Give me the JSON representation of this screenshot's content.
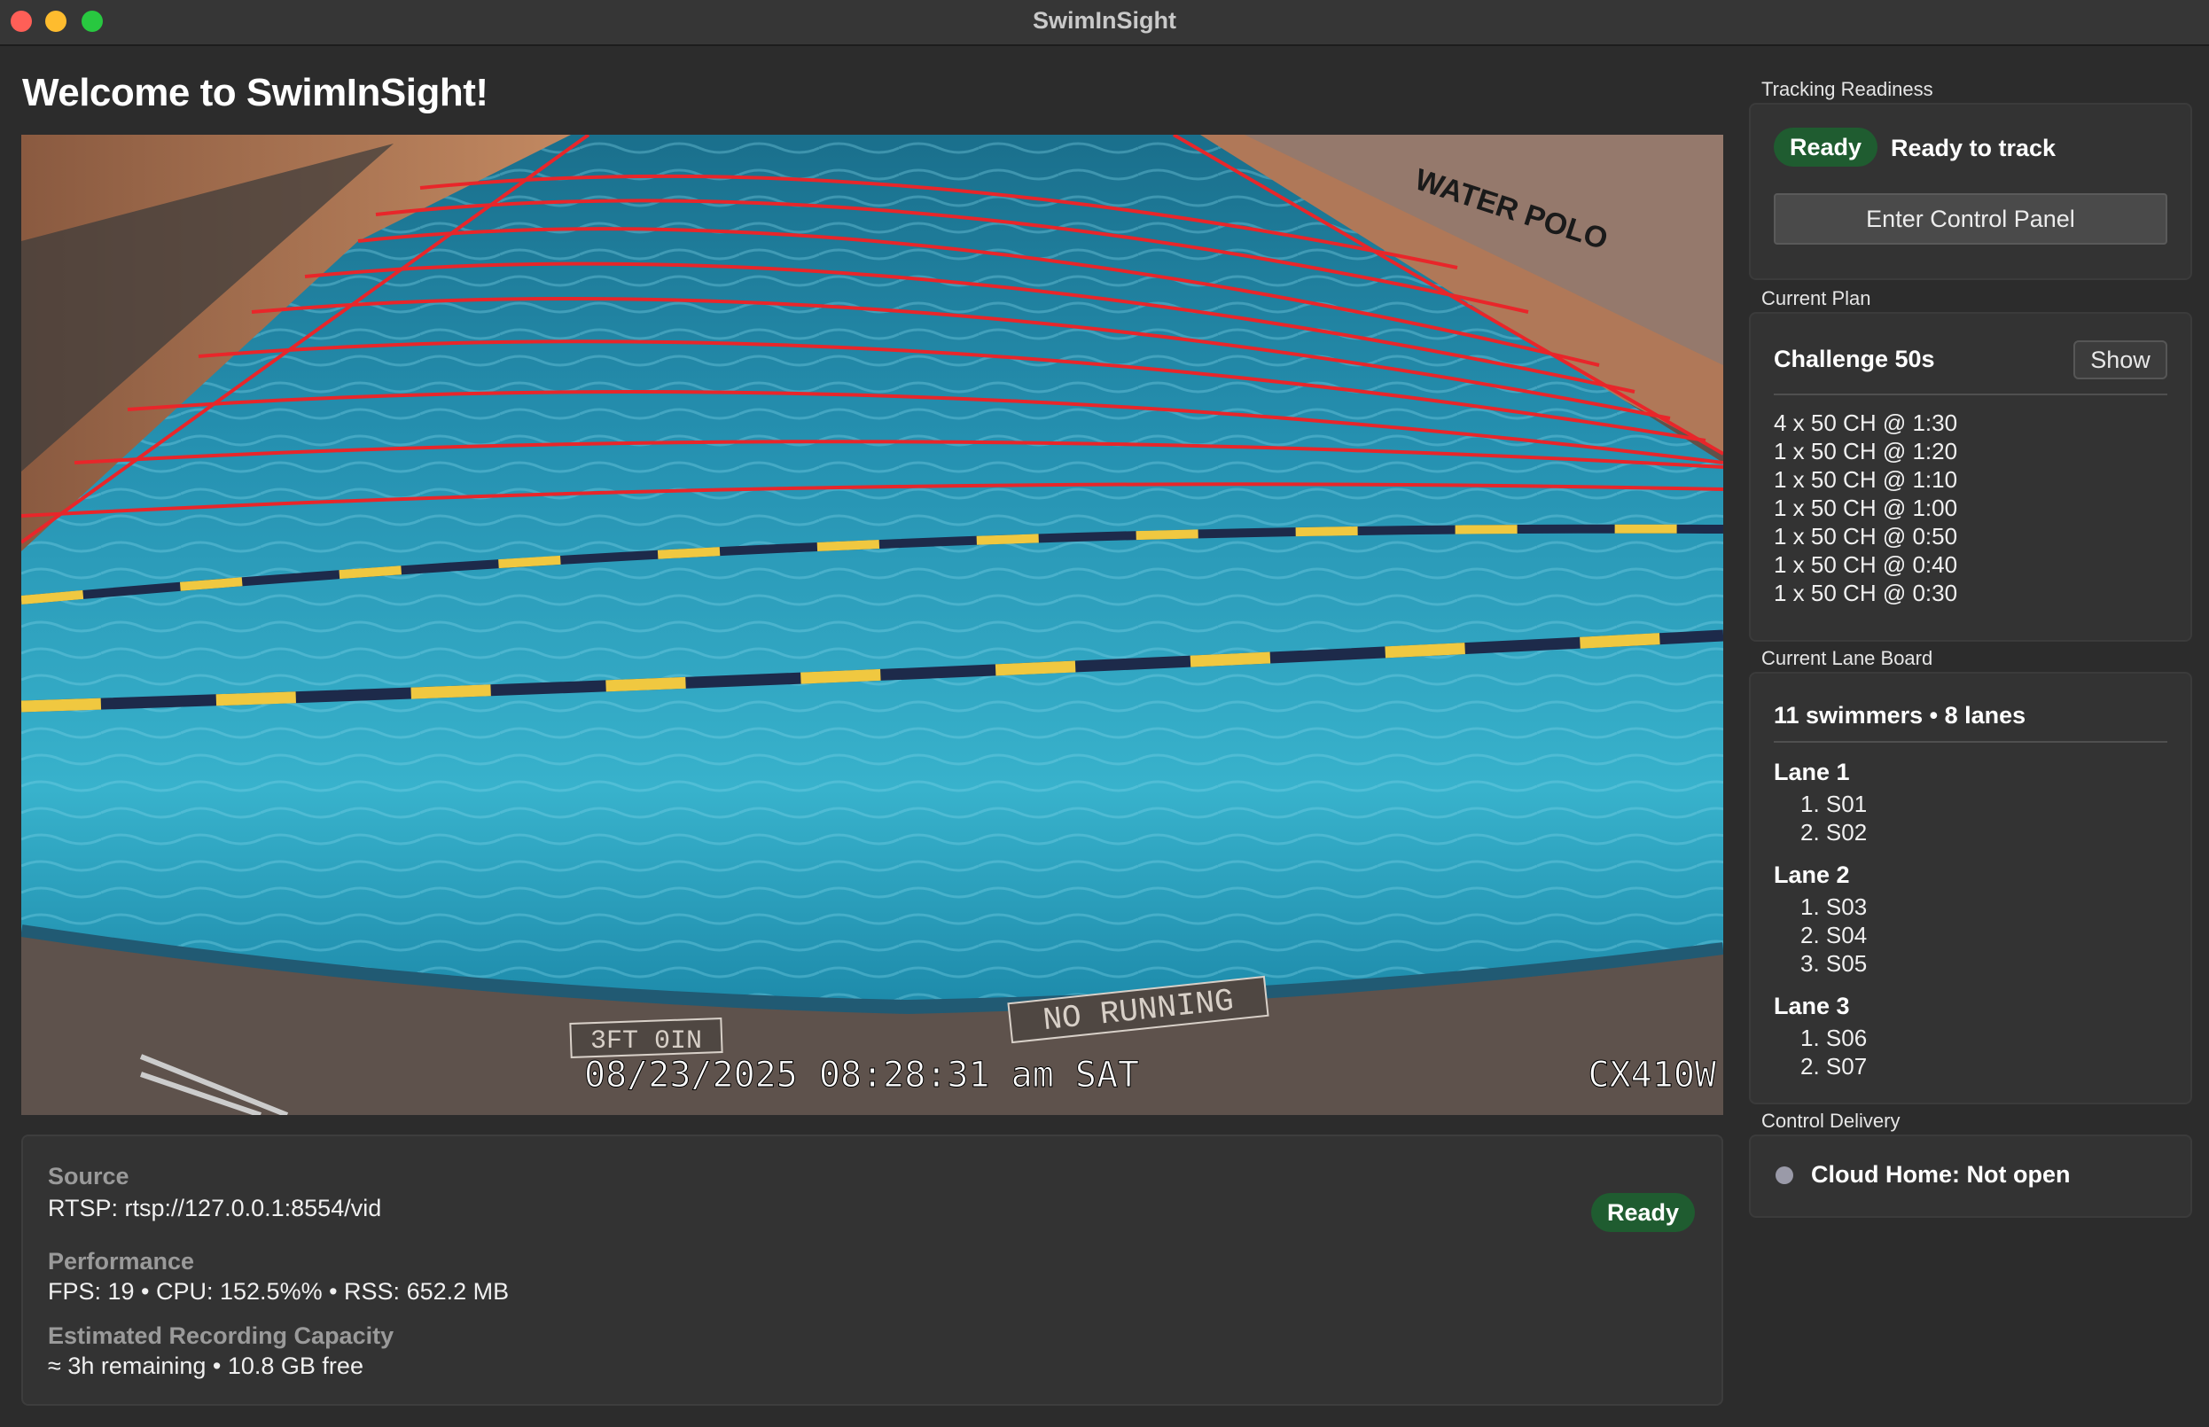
{
  "window": {
    "title": "SwimInSight"
  },
  "main": {
    "welcome": "Welcome to SwimInSight!",
    "video": {
      "overlay_datetime": "08/23/2025 08:28:31 am SAT",
      "overlay_camera": "CX410W",
      "sign_no_running": "NO RUNNING",
      "depth_marking": "3FT 0IN",
      "banner": "WATER POLO"
    },
    "info": {
      "source_label": "Source",
      "source_value": "RTSP: rtsp://127.0.0.1:8554/vid",
      "status": "Ready",
      "performance_label": "Performance",
      "performance_value": "FPS: 19 • CPU: 152.5%% • RSS: 652.2 MB",
      "capacity_label": "Estimated Recording Capacity",
      "capacity_value": "≈ 3h remaining • 10.8 GB free"
    }
  },
  "sidebar": {
    "tracking": {
      "label": "Tracking Readiness",
      "pill": "Ready",
      "status_text": "Ready to track",
      "button": "Enter Control Panel"
    },
    "plan": {
      "label": "Current Plan",
      "name": "Challenge 50s",
      "show_button": "Show",
      "items": [
        "4 x 50 CH @ 1:30",
        "1 x 50 CH @ 1:20",
        "1 x 50 CH @ 1:10",
        "1 x 50 CH @ 1:00",
        "1 x 50 CH @ 0:50",
        "1 x 50 CH @ 0:40",
        "1 x 50 CH @ 0:30"
      ]
    },
    "lane_board": {
      "label": "Current Lane Board",
      "summary": "11 swimmers • 8 lanes",
      "lanes": [
        {
          "name": "Lane 1",
          "swimmers": [
            "1. S01",
            "2. S02"
          ]
        },
        {
          "name": "Lane 2",
          "swimmers": [
            "1. S03",
            "2. S04",
            "3. S05"
          ]
        },
        {
          "name": "Lane 3",
          "swimmers": [
            "1. S06",
            "2. S07"
          ]
        }
      ]
    },
    "delivery": {
      "label": "Control Delivery",
      "status": "Cloud Home: Not open"
    }
  },
  "colors": {
    "ready_green": "#1f5c30",
    "window_bg": "#2c2c2c",
    "card_bg": "#333333",
    "lane_overlay_red": "#e8262a"
  }
}
